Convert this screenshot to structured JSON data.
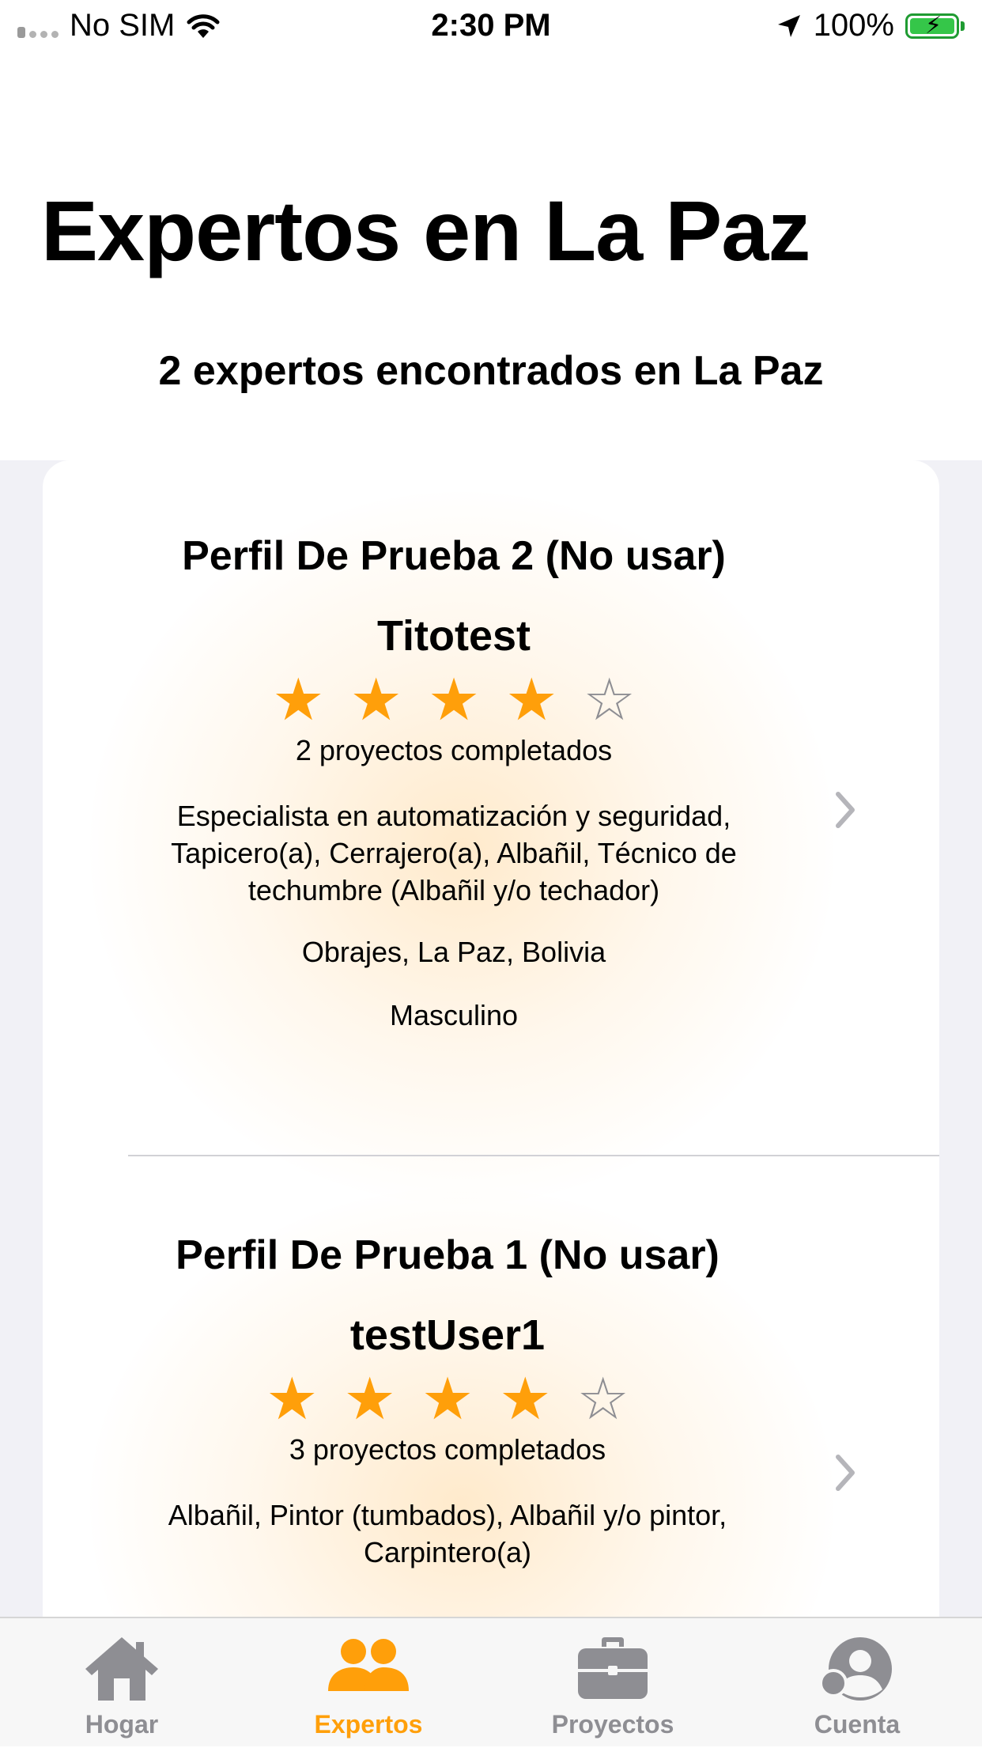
{
  "status_bar": {
    "carrier": "No SIM",
    "time": "2:30 PM",
    "battery": "100%"
  },
  "header": {
    "title": "Expertos en La Paz",
    "subtitle": "2 expertos encontrados en La Paz"
  },
  "experts": [
    {
      "name": "Perfil De Prueba 2 (No usar)",
      "username": "Titotest",
      "rating": 4,
      "rating_max": 5,
      "projects": "2 proyectos completados",
      "specialties": "Especialista en automatización y seguridad, Tapicero(a), Cerrajero(a), Albañil, Técnico de techumbre (Albañil y/o techador)",
      "location": "Obrajes, La Paz, Bolivia",
      "gender": "Masculino"
    },
    {
      "name": "Perfil De Prueba 1 (No usar)",
      "username": "testUser1",
      "rating": 4,
      "rating_max": 5,
      "projects": "3 proyectos completados",
      "specialties": "Albañil, Pintor (tumbados), Albañil y/o pintor, Carpintero(a)"
    }
  ],
  "tabs": [
    {
      "label": "Hogar",
      "icon": "house-icon",
      "active": false
    },
    {
      "label": "Expertos",
      "icon": "people-icon",
      "active": true
    },
    {
      "label": "Proyectos",
      "icon": "briefcase-icon",
      "active": false
    },
    {
      "label": "Cuenta",
      "icon": "account-icon",
      "active": false
    }
  ],
  "colors": {
    "accent": "#ff9f0a",
    "inactive": "#8e8e93",
    "list_background": "#f1f1f6"
  }
}
